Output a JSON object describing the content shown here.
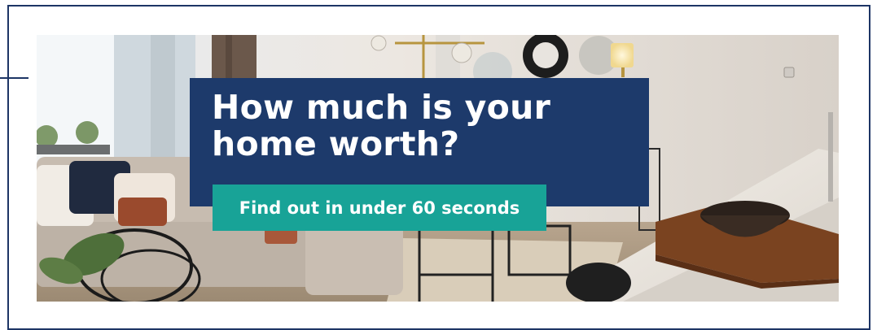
{
  "banner": {
    "headline": "How much is your\nhome worth?",
    "cta_label": "Find out in under 60 seconds"
  },
  "colors": {
    "frame": "#1d3565",
    "headline_bg": "#1d3a6b",
    "cta_bg": "#18a397",
    "text": "#ffffff"
  },
  "image": {
    "subject": "living-room-photo"
  }
}
